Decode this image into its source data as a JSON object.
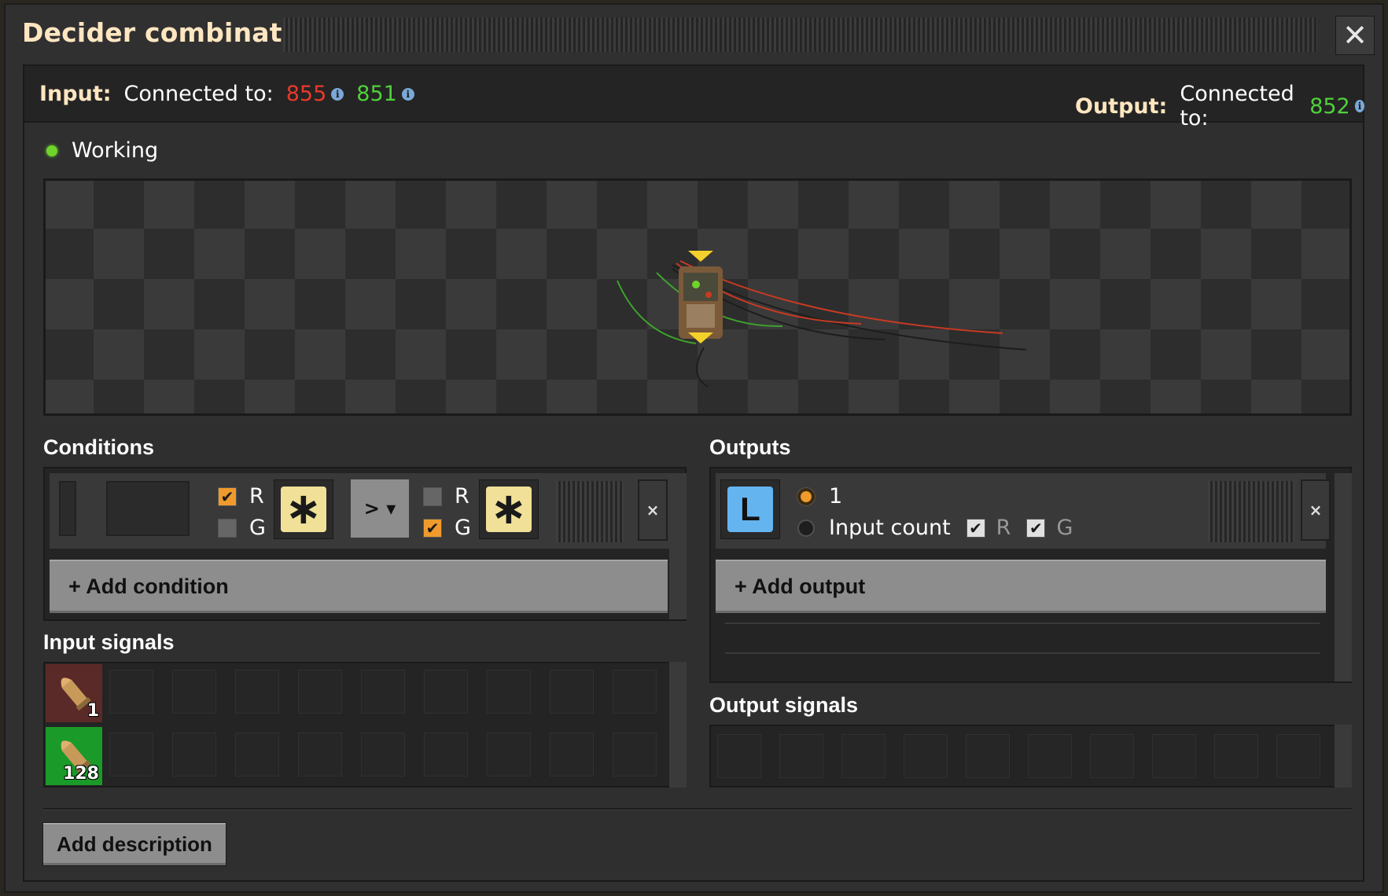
{
  "window": {
    "title": "Decider combinator",
    "close_label": "✕"
  },
  "connections": {
    "input": {
      "label": "Input:",
      "text": "Connected to:",
      "red": "855",
      "green": "851"
    },
    "output": {
      "label": "Output:",
      "text": "Connected to:",
      "green": "852"
    },
    "info_icon": "i"
  },
  "status": {
    "text": "Working",
    "color": "#6ed42b"
  },
  "sections": {
    "conditions": "Conditions",
    "outputs": "Outputs",
    "input_signals": "Input signals",
    "output_signals": "Output signals"
  },
  "condition": {
    "left": {
      "r_label": "R",
      "g_label": "G",
      "r_checked": true,
      "g_checked": false,
      "signal": "∗"
    },
    "comparator": "> ▾",
    "right": {
      "r_label": "R",
      "g_label": "G",
      "r_checked": false,
      "g_checked": true,
      "signal": "∗"
    },
    "remove_label": "×",
    "add_label": "+ Add condition"
  },
  "output": {
    "signal": "L",
    "option_constant": "1",
    "option_input_count": "Input count",
    "constant_selected": true,
    "r_label": "R",
    "g_label": "G",
    "r_checked": true,
    "g_checked": true,
    "remove_label": "×",
    "add_label": "+ Add output"
  },
  "input_signals": [
    {
      "icon": "firearm-magazine-icon",
      "wire": "red",
      "count": "1"
    },
    {
      "icon": "firearm-magazine-icon",
      "wire": "green",
      "count": "128"
    }
  ],
  "description_button": "Add description",
  "colors": {
    "red_wire": "#e83a2a",
    "green_wire": "#4fd13a",
    "accent": "#ffe6c0",
    "checkbox": "#ef9a2c"
  }
}
